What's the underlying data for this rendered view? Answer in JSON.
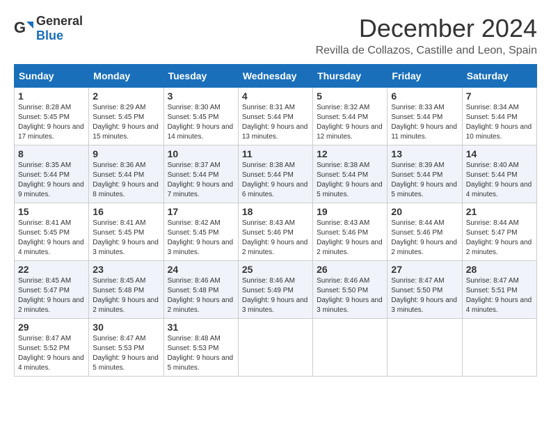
{
  "header": {
    "logo_general": "General",
    "logo_blue": "Blue",
    "month_title": "December 2024",
    "subtitle": "Revilla de Collazos, Castille and Leon, Spain"
  },
  "days_of_week": [
    "Sunday",
    "Monday",
    "Tuesday",
    "Wednesday",
    "Thursday",
    "Friday",
    "Saturday"
  ],
  "weeks": [
    [
      {
        "day": "1",
        "sunrise": "Sunrise: 8:28 AM",
        "sunset": "Sunset: 5:45 PM",
        "daylight": "Daylight: 9 hours and 17 minutes."
      },
      {
        "day": "2",
        "sunrise": "Sunrise: 8:29 AM",
        "sunset": "Sunset: 5:45 PM",
        "daylight": "Daylight: 9 hours and 15 minutes."
      },
      {
        "day": "3",
        "sunrise": "Sunrise: 8:30 AM",
        "sunset": "Sunset: 5:45 PM",
        "daylight": "Daylight: 9 hours and 14 minutes."
      },
      {
        "day": "4",
        "sunrise": "Sunrise: 8:31 AM",
        "sunset": "Sunset: 5:44 PM",
        "daylight": "Daylight: 9 hours and 13 minutes."
      },
      {
        "day": "5",
        "sunrise": "Sunrise: 8:32 AM",
        "sunset": "Sunset: 5:44 PM",
        "daylight": "Daylight: 9 hours and 12 minutes."
      },
      {
        "day": "6",
        "sunrise": "Sunrise: 8:33 AM",
        "sunset": "Sunset: 5:44 PM",
        "daylight": "Daylight: 9 hours and 11 minutes."
      },
      {
        "day": "7",
        "sunrise": "Sunrise: 8:34 AM",
        "sunset": "Sunset: 5:44 PM",
        "daylight": "Daylight: 9 hours and 10 minutes."
      }
    ],
    [
      {
        "day": "8",
        "sunrise": "Sunrise: 8:35 AM",
        "sunset": "Sunset: 5:44 PM",
        "daylight": "Daylight: 9 hours and 9 minutes."
      },
      {
        "day": "9",
        "sunrise": "Sunrise: 8:36 AM",
        "sunset": "Sunset: 5:44 PM",
        "daylight": "Daylight: 9 hours and 8 minutes."
      },
      {
        "day": "10",
        "sunrise": "Sunrise: 8:37 AM",
        "sunset": "Sunset: 5:44 PM",
        "daylight": "Daylight: 9 hours and 7 minutes."
      },
      {
        "day": "11",
        "sunrise": "Sunrise: 8:38 AM",
        "sunset": "Sunset: 5:44 PM",
        "daylight": "Daylight: 9 hours and 6 minutes."
      },
      {
        "day": "12",
        "sunrise": "Sunrise: 8:38 AM",
        "sunset": "Sunset: 5:44 PM",
        "daylight": "Daylight: 9 hours and 5 minutes."
      },
      {
        "day": "13",
        "sunrise": "Sunrise: 8:39 AM",
        "sunset": "Sunset: 5:44 PM",
        "daylight": "Daylight: 9 hours and 5 minutes."
      },
      {
        "day": "14",
        "sunrise": "Sunrise: 8:40 AM",
        "sunset": "Sunset: 5:44 PM",
        "daylight": "Daylight: 9 hours and 4 minutes."
      }
    ],
    [
      {
        "day": "15",
        "sunrise": "Sunrise: 8:41 AM",
        "sunset": "Sunset: 5:45 PM",
        "daylight": "Daylight: 9 hours and 4 minutes."
      },
      {
        "day": "16",
        "sunrise": "Sunrise: 8:41 AM",
        "sunset": "Sunset: 5:45 PM",
        "daylight": "Daylight: 9 hours and 3 minutes."
      },
      {
        "day": "17",
        "sunrise": "Sunrise: 8:42 AM",
        "sunset": "Sunset: 5:45 PM",
        "daylight": "Daylight: 9 hours and 3 minutes."
      },
      {
        "day": "18",
        "sunrise": "Sunrise: 8:43 AM",
        "sunset": "Sunset: 5:46 PM",
        "daylight": "Daylight: 9 hours and 2 minutes."
      },
      {
        "day": "19",
        "sunrise": "Sunrise: 8:43 AM",
        "sunset": "Sunset: 5:46 PM",
        "daylight": "Daylight: 9 hours and 2 minutes."
      },
      {
        "day": "20",
        "sunrise": "Sunrise: 8:44 AM",
        "sunset": "Sunset: 5:46 PM",
        "daylight": "Daylight: 9 hours and 2 minutes."
      },
      {
        "day": "21",
        "sunrise": "Sunrise: 8:44 AM",
        "sunset": "Sunset: 5:47 PM",
        "daylight": "Daylight: 9 hours and 2 minutes."
      }
    ],
    [
      {
        "day": "22",
        "sunrise": "Sunrise: 8:45 AM",
        "sunset": "Sunset: 5:47 PM",
        "daylight": "Daylight: 9 hours and 2 minutes."
      },
      {
        "day": "23",
        "sunrise": "Sunrise: 8:45 AM",
        "sunset": "Sunset: 5:48 PM",
        "daylight": "Daylight: 9 hours and 2 minutes."
      },
      {
        "day": "24",
        "sunrise": "Sunrise: 8:46 AM",
        "sunset": "Sunset: 5:48 PM",
        "daylight": "Daylight: 9 hours and 2 minutes."
      },
      {
        "day": "25",
        "sunrise": "Sunrise: 8:46 AM",
        "sunset": "Sunset: 5:49 PM",
        "daylight": "Daylight: 9 hours and 3 minutes."
      },
      {
        "day": "26",
        "sunrise": "Sunrise: 8:46 AM",
        "sunset": "Sunset: 5:50 PM",
        "daylight": "Daylight: 9 hours and 3 minutes."
      },
      {
        "day": "27",
        "sunrise": "Sunrise: 8:47 AM",
        "sunset": "Sunset: 5:50 PM",
        "daylight": "Daylight: 9 hours and 3 minutes."
      },
      {
        "day": "28",
        "sunrise": "Sunrise: 8:47 AM",
        "sunset": "Sunset: 5:51 PM",
        "daylight": "Daylight: 9 hours and 4 minutes."
      }
    ],
    [
      {
        "day": "29",
        "sunrise": "Sunrise: 8:47 AM",
        "sunset": "Sunset: 5:52 PM",
        "daylight": "Daylight: 9 hours and 4 minutes."
      },
      {
        "day": "30",
        "sunrise": "Sunrise: 8:47 AM",
        "sunset": "Sunset: 5:53 PM",
        "daylight": "Daylight: 9 hours and 5 minutes."
      },
      {
        "day": "31",
        "sunrise": "Sunrise: 8:48 AM",
        "sunset": "Sunset: 5:53 PM",
        "daylight": "Daylight: 9 hours and 5 minutes."
      },
      null,
      null,
      null,
      null
    ]
  ]
}
